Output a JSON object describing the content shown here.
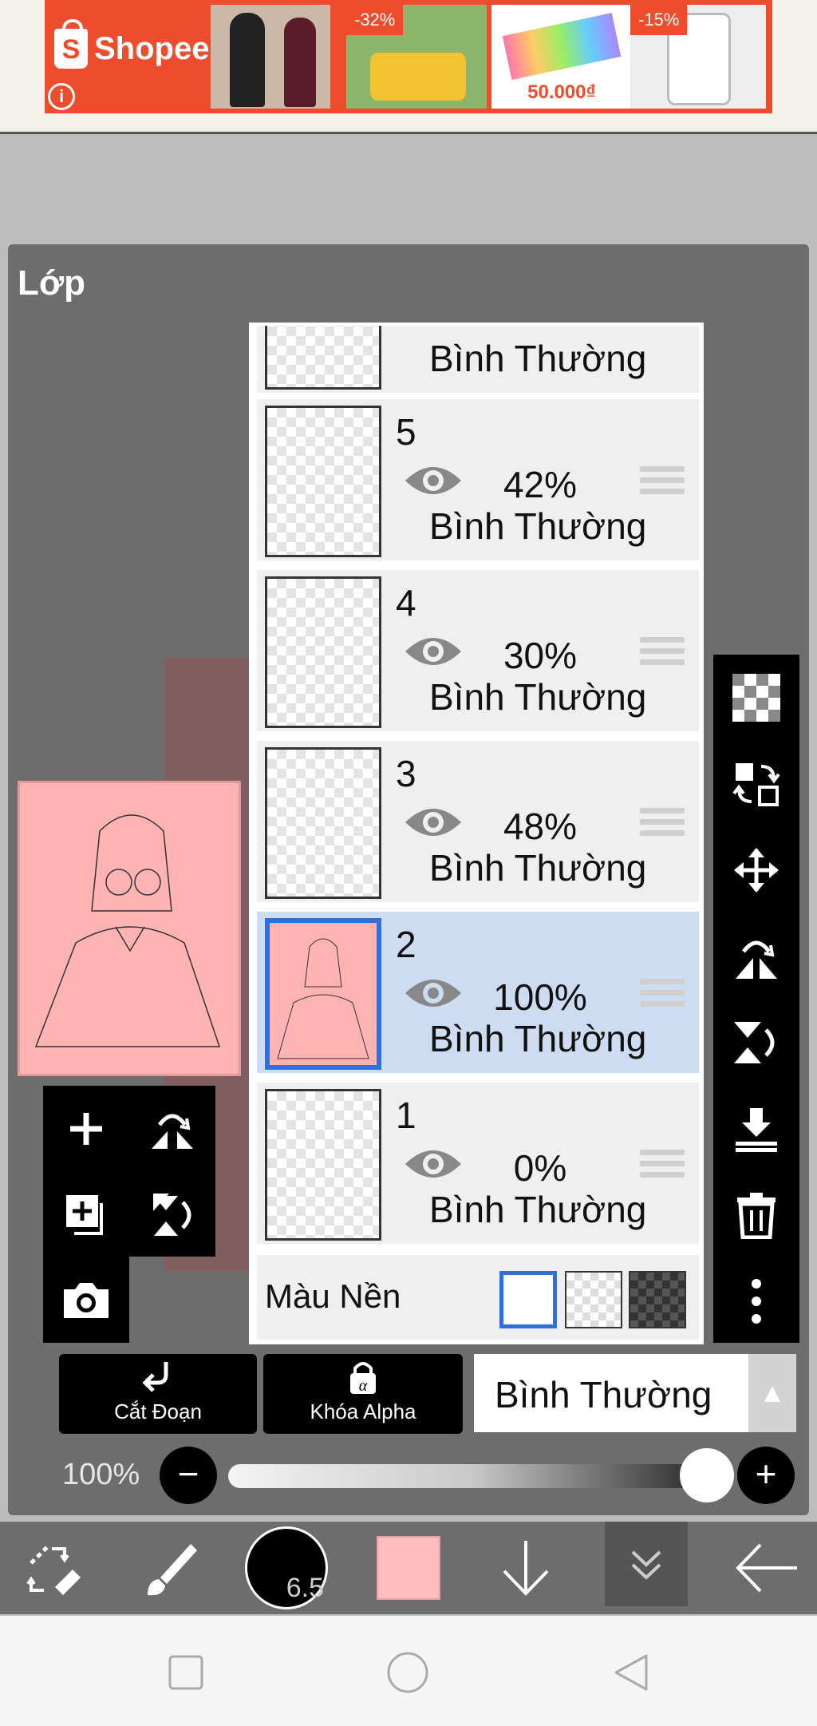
{
  "ad": {
    "brand": "Shopee",
    "info_glyph": "i",
    "badges": [
      "-32%",
      "-15%"
    ],
    "price": "50.000₫"
  },
  "panel": {
    "title": "Lớp"
  },
  "layers": [
    {
      "name": "",
      "opacity": "",
      "blend": "Bình Thường"
    },
    {
      "name": "5",
      "opacity": "42%",
      "blend": "Bình Thường"
    },
    {
      "name": "4",
      "opacity": "30%",
      "blend": "Bình Thường"
    },
    {
      "name": "3",
      "opacity": "48%",
      "blend": "Bình Thường"
    },
    {
      "name": "2",
      "opacity": "100%",
      "blend": "Bình Thường",
      "selected": true
    },
    {
      "name": "1",
      "opacity": "0%",
      "blend": "Bình Thường"
    }
  ],
  "background": {
    "label": "Màu Nền",
    "options": [
      "white",
      "transparent",
      "dark-checker"
    ],
    "selected": "white"
  },
  "bottom": {
    "clip_label": "Cắt Đoạn",
    "alpha_lock_label": "Khóa Alpha",
    "blend_mode": "Bình Thường",
    "opacity_label": "100%",
    "opacity_value": 1.0,
    "minus": "−",
    "plus": "+"
  },
  "toolbar": {
    "brush_size": "6.5",
    "color": "#ffbcbc"
  },
  "colors": {
    "panel": "#6d6d6d",
    "selected_row": "#cddcf0",
    "accent": "#2f6fd9",
    "shopee": "#ee4d2d",
    "canvas_pink": "#ffb3b3"
  }
}
